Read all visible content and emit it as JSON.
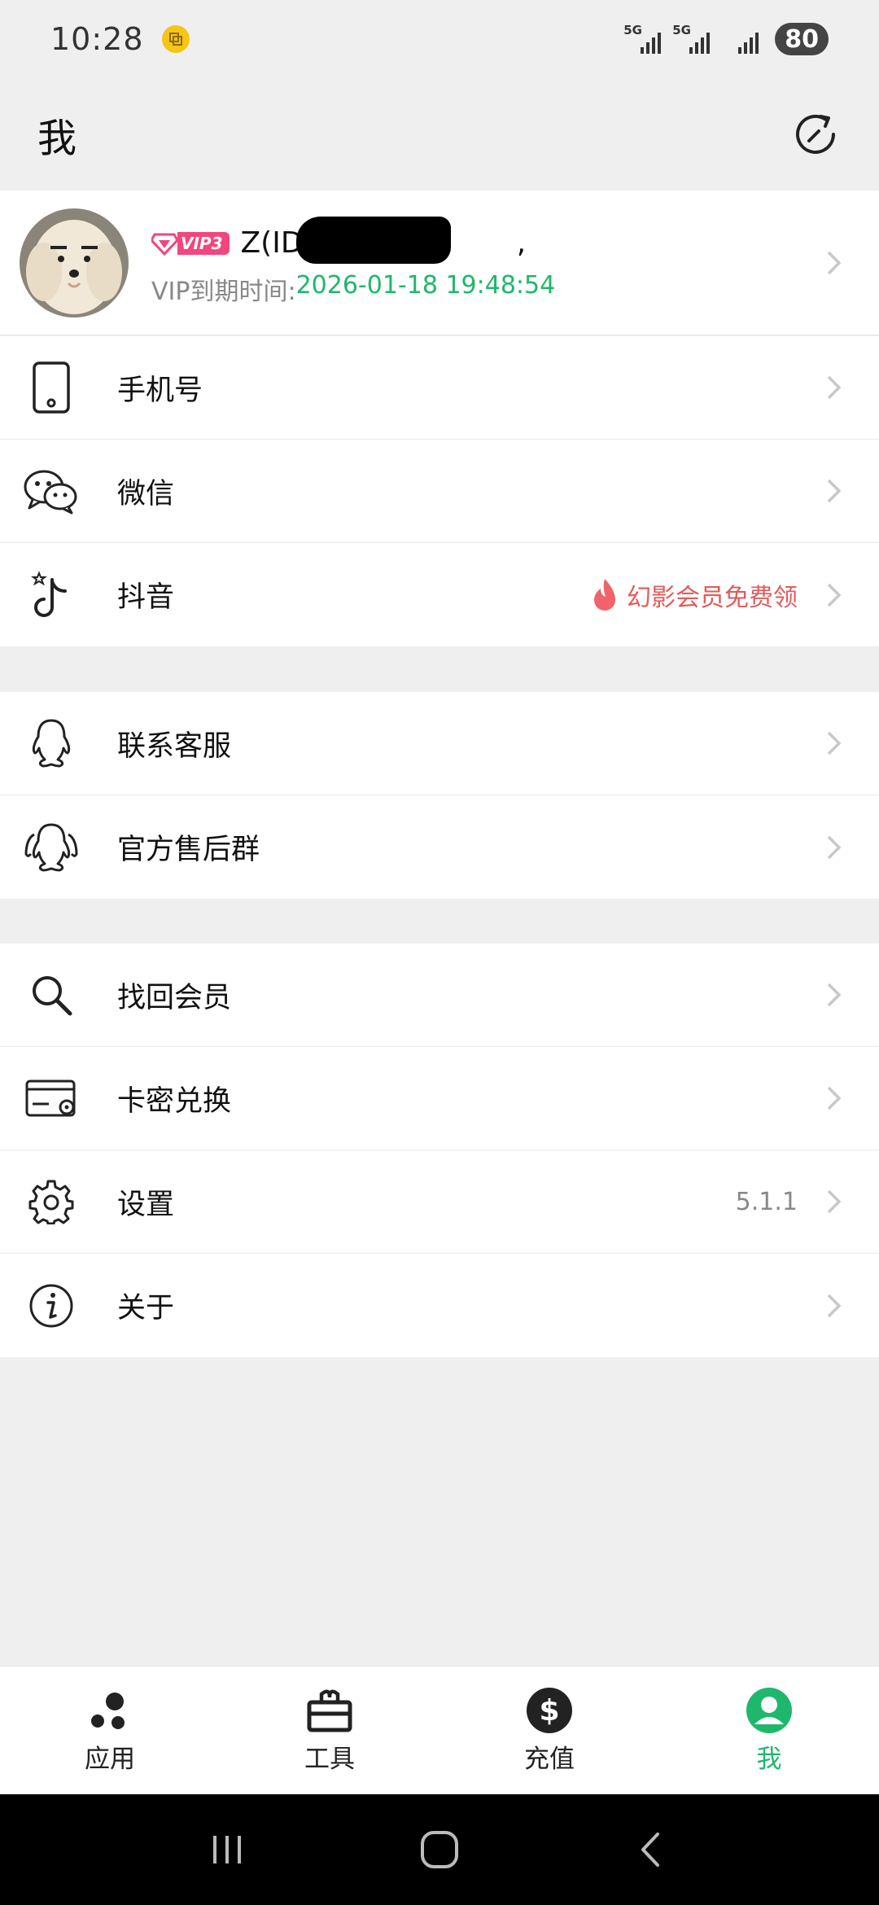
{
  "status_bar": {
    "time": "10:28",
    "network1": "5G",
    "network2": "5G",
    "battery": "80"
  },
  "header": {
    "title": "我"
  },
  "profile": {
    "vip_level": "VIP3",
    "username": "Z(ID:",
    "username_suffix": ",",
    "vip_expiry_label": "VIP到期时间:",
    "vip_expiry_value": "2026-01-18 19:48:54"
  },
  "group1": [
    {
      "label": "手机号",
      "extra": ""
    },
    {
      "label": "微信",
      "extra": ""
    },
    {
      "label": "抖音",
      "extra": "幻影会员免费领"
    }
  ],
  "group2": [
    {
      "label": "联系客服",
      "extra": ""
    },
    {
      "label": "官方售后群",
      "extra": ""
    }
  ],
  "group3": [
    {
      "label": "找回会员",
      "extra": ""
    },
    {
      "label": "卡密兑换",
      "extra": ""
    },
    {
      "label": "设置",
      "extra": "5.1.1"
    },
    {
      "label": "关于",
      "extra": ""
    }
  ],
  "bottom_nav": [
    {
      "label": "应用",
      "icon": "apps-icon"
    },
    {
      "label": "工具",
      "icon": "toolbox-icon"
    },
    {
      "label": "充值",
      "icon": "dollar-icon"
    },
    {
      "label": "我",
      "icon": "user-icon",
      "active": true
    }
  ],
  "colors": {
    "accent": "#1fb76c",
    "promo": "#e35a5a",
    "vip_badge": "#f2467d"
  }
}
